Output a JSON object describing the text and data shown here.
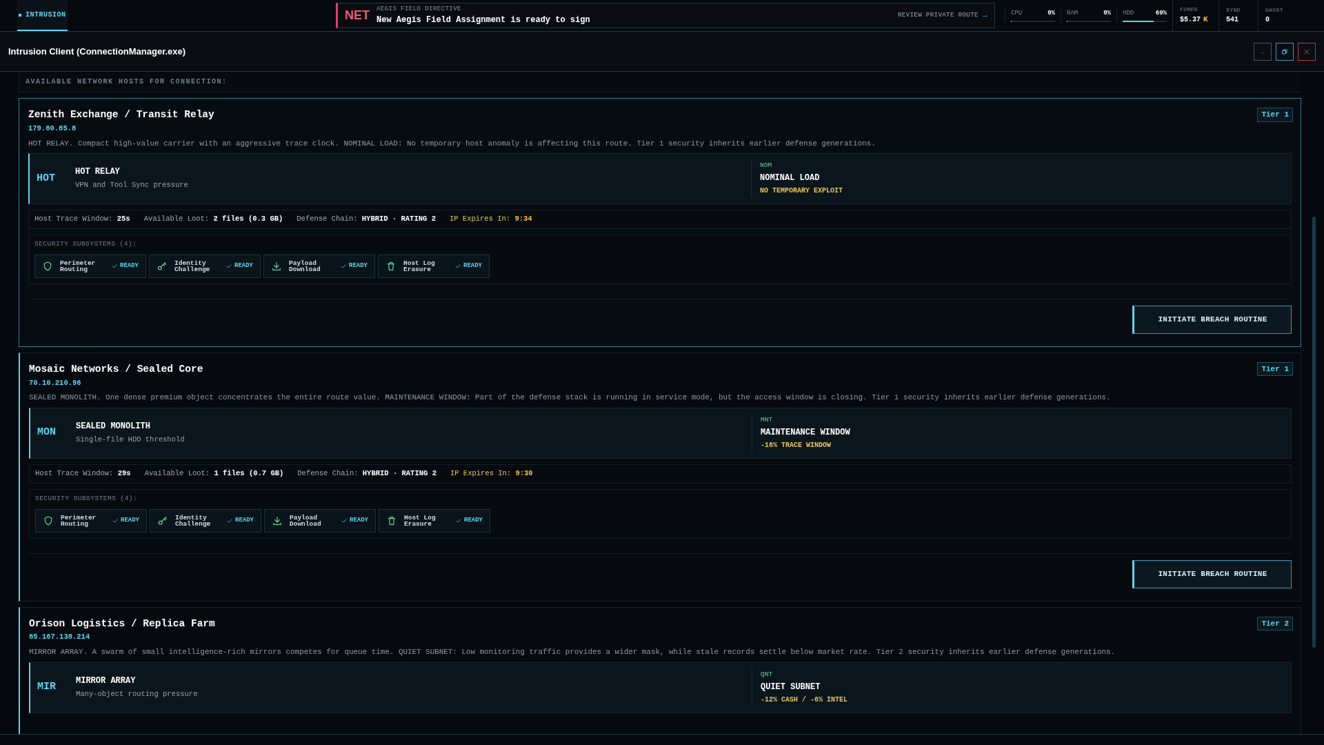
{
  "top_bar": {
    "tabs": [
      {
        "label": "INTRUSION",
        "selected": true
      }
    ],
    "directive": {
      "badge": "NET",
      "label": "AEGIS FIELD DIRECTIVE",
      "title": "New Aegis Field Assignment is ready to sign",
      "action": "REVIEW PRIVATE ROUTE",
      "action_icon": "→"
    },
    "meters": [
      {
        "name": "CPU",
        "reading": "0%",
        "level": 0
      },
      {
        "name": "RAM",
        "reading": "0%",
        "level": 0
      },
      {
        "name": "HDD",
        "reading": "69%",
        "level": 0.69
      }
    ],
    "stats": [
      {
        "label": "FUNDS",
        "value": "$5.37",
        "unit": "K"
      },
      {
        "label": "SYND",
        "value": "541"
      },
      {
        "label": "GHOST",
        "value": "0"
      }
    ]
  },
  "window": {
    "title": "Intrusion Client (ConnectionManager.exe)",
    "controls": [
      "—"
    ]
  },
  "hosts_header": "AVAILABLE NETWORK HOSTS FOR CONNECTION:",
  "hosts": [
    {
      "name": "Zenith Exchange / Transit Relay",
      "ip": "179.80.85.8",
      "tier": "Tier 1",
      "selected": true,
      "description": "HOT RELAY. Compact high-value carrier with an aggressive trace clock. NOMINAL LOAD: No temporary host anomaly is affecting this route. Tier 1 security inherits earlier defense generations.",
      "profile": {
        "code": "HOT",
        "name": "HOT RELAY",
        "detail": "VPN and Tool Sync pressure"
      },
      "modifier": {
        "code": "NOM",
        "name": "NOMINAL LOAD",
        "effect": "NO TEMPORARY EXPLOIT"
      },
      "stats": [
        {
          "label": "Host Trace Window:",
          "value": "25s",
          "kind": "plain"
        },
        {
          "label": "Available Loot:",
          "value": "2 files (0.3 GB)",
          "kind": "plain"
        },
        {
          "label": "Defense Chain:",
          "value": "HYBRID · RATING 2",
          "kind": "plain"
        },
        {
          "label": "IP Expires In:",
          "value": "9:34",
          "kind": "warning"
        }
      ],
      "subsystems_title": "SECURITY SUBSYSTEMS (4):",
      "subsystems": [
        {
          "kind": "shield",
          "name": "Perimeter Routing",
          "status": "READY"
        },
        {
          "kind": "key",
          "name": "Identity Challenge",
          "status": "READY"
        },
        {
          "kind": "download",
          "name": "Payload Download",
          "status": "READY"
        },
        {
          "kind": "trash",
          "name": "Host Log Erasure",
          "status": "READY"
        }
      ],
      "action": "INITIATE BREACH ROUTINE"
    },
    {
      "name": "Mosaic Networks / Sealed Core",
      "ip": "70.10.210.96",
      "tier": "Tier 1",
      "selected": false,
      "description": "SEALED MONOLITH. One dense premium object concentrates the entire route value. MAINTENANCE WINDOW: Part of the defense stack is running in service mode, but the access window is closing. Tier 1 security inherits earlier defense generations.",
      "profile": {
        "code": "MON",
        "name": "SEALED MONOLITH",
        "detail": "Single-file HDD threshold"
      },
      "modifier": {
        "code": "MNT",
        "name": "MAINTENANCE WINDOW",
        "effect": "-16% TRACE WINDOW"
      },
      "stats": [
        {
          "label": "Host Trace Window:",
          "value": "29s",
          "kind": "plain"
        },
        {
          "label": "Available Loot:",
          "value": "1 files (0.7 GB)",
          "kind": "plain"
        },
        {
          "label": "Defense Chain:",
          "value": "HYBRID · RATING 2",
          "kind": "plain"
        },
        {
          "label": "IP Expires In:",
          "value": "9:30",
          "kind": "warning"
        }
      ],
      "subsystems_title": "SECURITY SUBSYSTEMS (4):",
      "subsystems": [
        {
          "kind": "shield",
          "name": "Perimeter Routing",
          "status": "READY"
        },
        {
          "kind": "key",
          "name": "Identity Challenge",
          "status": "READY"
        },
        {
          "kind": "download",
          "name": "Payload Download",
          "status": "READY"
        },
        {
          "kind": "trash",
          "name": "Host Log Erasure",
          "status": "READY"
        }
      ],
      "action": "INITIATE BREACH ROUTINE"
    },
    {
      "name": "Orison Logistics / Replica Farm",
      "ip": "85.167.138.214",
      "tier": "Tier 2",
      "selected": false,
      "description": "MIRROR ARRAY. A swarm of small intelligence-rich mirrors competes for queue time. QUIET SUBNET: Low monitoring traffic provides a wider mask, while stale records settle below market rate. Tier 2 security inherits earlier defense generations.",
      "profile": {
        "code": "MIR",
        "name": "MIRROR ARRAY",
        "detail": "Many-object routing pressure"
      },
      "modifier": {
        "code": "QNT",
        "name": "QUIET SUBNET",
        "effect": "-12% CASH / -6% INTEL"
      }
    }
  ]
}
